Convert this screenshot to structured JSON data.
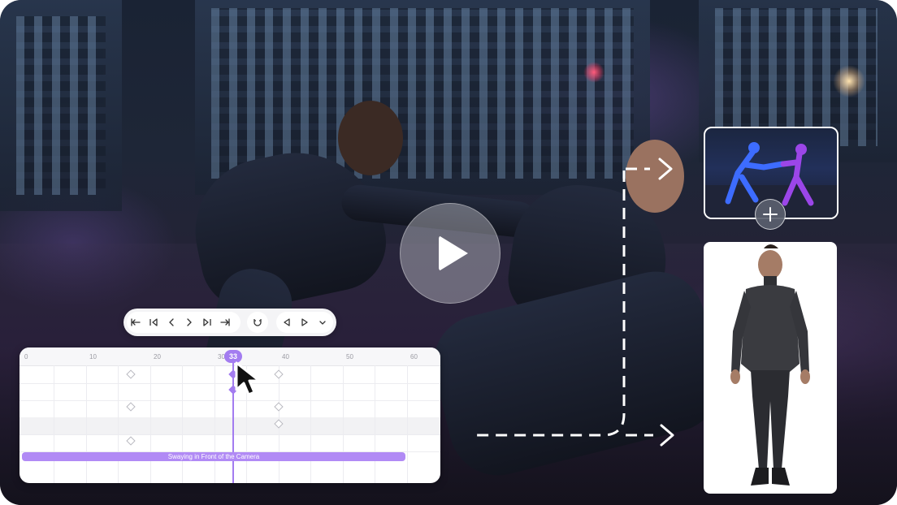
{
  "player": {
    "play_icon": "play-icon"
  },
  "reference": {
    "add_icon": "plus-icon",
    "add_glyph": "+"
  },
  "toolbar": {
    "buttons": [
      {
        "name": "jump-start-icon"
      },
      {
        "name": "prev-keyframe-icon"
      },
      {
        "name": "step-back-icon"
      },
      {
        "name": "step-forward-icon"
      },
      {
        "name": "next-keyframe-icon"
      },
      {
        "name": "jump-end-icon"
      },
      {
        "name": "magnet-icon"
      },
      {
        "name": "play-reverse-icon"
      },
      {
        "name": "play-forward-icon"
      },
      {
        "name": "chevron-down-icon"
      }
    ]
  },
  "timeline": {
    "ruler_labels": [
      "0",
      "10",
      "20",
      "30",
      "40",
      "50",
      "60"
    ],
    "current_frame": "33",
    "clip_label": "Swaying in Front of the Camera",
    "accent": "#a37cf0"
  }
}
